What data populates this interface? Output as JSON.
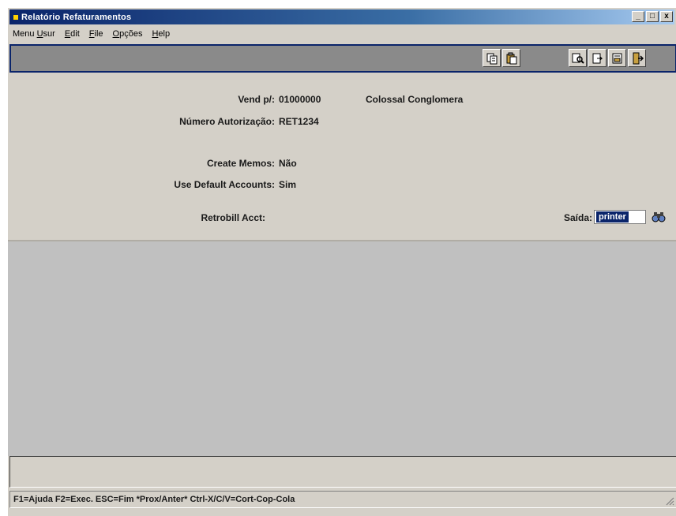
{
  "window": {
    "title": "Relatório Refaturamentos",
    "minimize": "_",
    "maximize": "□",
    "close": "x"
  },
  "menu": [
    {
      "pre": "Menu ",
      "u": "U",
      "post": "sur"
    },
    {
      "pre": "",
      "u": "E",
      "post": "dit"
    },
    {
      "pre": "",
      "u": "F",
      "post": "ile"
    },
    {
      "pre": "",
      "u": "O",
      "post": "pções"
    },
    {
      "pre": "",
      "u": "H",
      "post": "elp"
    }
  ],
  "toolbar": {
    "icons": [
      "copy-icon",
      "paste-icon",
      "find-icon",
      "export-icon",
      "report-icon",
      "exit-icon"
    ]
  },
  "form": {
    "vend_label": "Vend p/:",
    "vend_code": "01000000",
    "vend_name": "Colossal Conglomera",
    "auth_label": "Número Autorização:",
    "auth_value": "RET1234",
    "memos_label": "Create Memos:",
    "memos_value": "Não",
    "accounts_label": "Use Default Accounts:",
    "accounts_value": "Sim",
    "retro_label": "Retrobill Acct:",
    "saida_label": "Saída:",
    "saida_value": "printer"
  },
  "status": {
    "text": "F1=Ajuda F2=Exec. ESC=Fim *Prox/Anter* Ctrl-X/C/V=Cort-Cop-Cola"
  },
  "colors": {
    "title_bar": "#0a246a",
    "toolbar": "#8a8a8a",
    "face": "#d4d0c8",
    "body": "#c0c0c0"
  }
}
